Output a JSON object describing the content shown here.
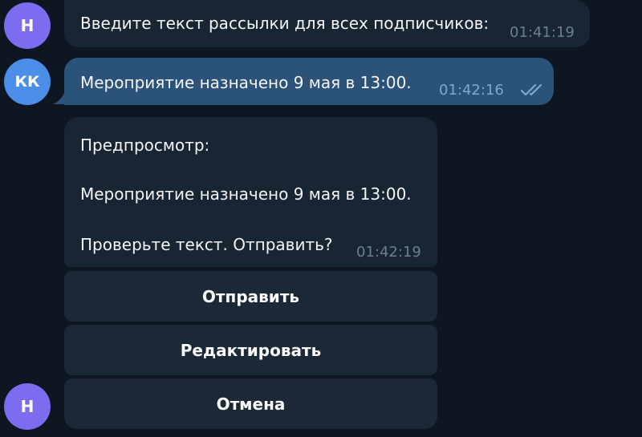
{
  "avatars": {
    "bot_initial": "Н",
    "user_initials": "КК"
  },
  "messages": [
    {
      "sender": "bot",
      "text": "Введите текст рассылки для всех подписчиков:",
      "time": "01:41:19"
    },
    {
      "sender": "user",
      "text": "Мероприятие назначено 9 мая в 13:00.",
      "time": "01:42:16",
      "status": "read"
    },
    {
      "sender": "bot",
      "lines": [
        "Предпросмотр:",
        "Мероприятие назначено 9 мая в 13:00.",
        "Проверьте текст. Отправить?"
      ],
      "time": "01:42:19"
    }
  ],
  "keyboard": {
    "send_label": "Отправить",
    "edit_label": "Редактировать",
    "cancel_label": "Отмена"
  },
  "colors": {
    "background": "#0e1621",
    "incoming_bubble": "#182533",
    "outgoing_bubble": "#2b5278",
    "button": "#1b2836",
    "bot_avatar": "#7b6cf0",
    "user_avatar": "#4b8ee8",
    "read_check": "#7da8cf"
  },
  "icons": {
    "read_status": "double-check-icon"
  }
}
